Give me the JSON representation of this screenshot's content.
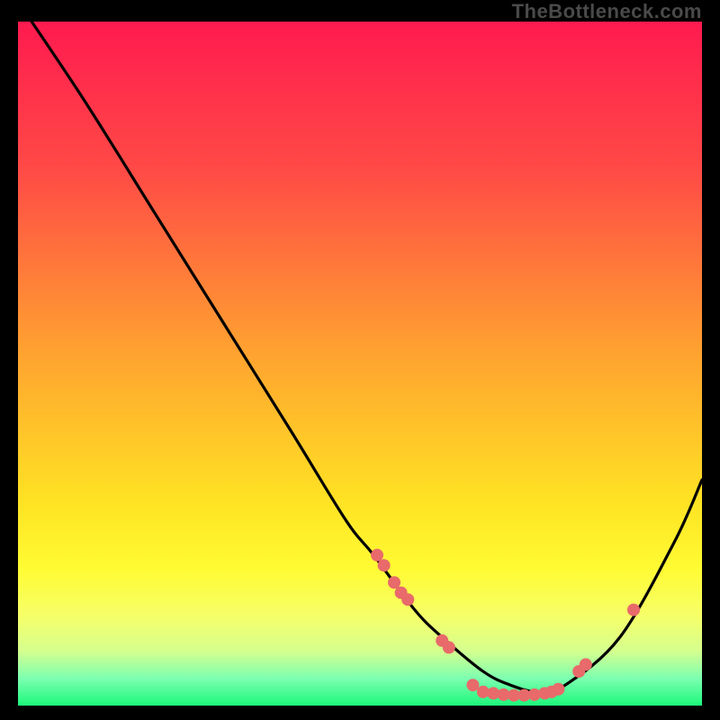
{
  "watermark": "TheBottleneck.com",
  "chart_data": {
    "type": "line",
    "title": "",
    "xlabel": "",
    "ylabel": "",
    "xlim": [
      0,
      100
    ],
    "ylim": [
      0,
      100
    ],
    "grid": false,
    "series": [
      {
        "name": "bottleneck-curve",
        "x": [
          2,
          10,
          20,
          30,
          40,
          48,
          52,
          58,
          62,
          68,
          72,
          76,
          80,
          88,
          96,
          100
        ],
        "values": [
          100,
          88,
          72,
          56,
          40,
          27,
          22,
          14,
          10,
          5,
          3,
          2,
          3,
          10,
          24,
          33
        ],
        "color": "#000000"
      }
    ],
    "markers": [
      {
        "x": 52.5,
        "y": 22.0
      },
      {
        "x": 53.5,
        "y": 20.5
      },
      {
        "x": 55.0,
        "y": 18.0
      },
      {
        "x": 56.0,
        "y": 16.5
      },
      {
        "x": 57.0,
        "y": 15.5
      },
      {
        "x": 62.0,
        "y": 9.5
      },
      {
        "x": 63.0,
        "y": 8.5
      },
      {
        "x": 66.5,
        "y": 3.0
      },
      {
        "x": 68.0,
        "y": 2.0
      },
      {
        "x": 69.5,
        "y": 1.8
      },
      {
        "x": 71.0,
        "y": 1.6
      },
      {
        "x": 72.5,
        "y": 1.5
      },
      {
        "x": 74.0,
        "y": 1.5
      },
      {
        "x": 75.5,
        "y": 1.6
      },
      {
        "x": 77.0,
        "y": 1.8
      },
      {
        "x": 78.0,
        "y": 2.0
      },
      {
        "x": 79.0,
        "y": 2.4
      },
      {
        "x": 82.0,
        "y": 5.0
      },
      {
        "x": 83.0,
        "y": 6.0
      },
      {
        "x": 90.0,
        "y": 14.0
      }
    ],
    "marker_color": "#e86a6a",
    "gradient_stops": [
      {
        "offset": 0,
        "color": "#ff1a4f"
      },
      {
        "offset": 22,
        "color": "#ff4b46"
      },
      {
        "offset": 48,
        "color": "#ffa130"
      },
      {
        "offset": 70,
        "color": "#ffe223"
      },
      {
        "offset": 80,
        "color": "#fffb33"
      },
      {
        "offset": 87,
        "color": "#f6ff6a"
      },
      {
        "offset": 92,
        "color": "#d5ff8e"
      },
      {
        "offset": 96,
        "color": "#7dffb0"
      },
      {
        "offset": 100,
        "color": "#1cf77b"
      }
    ]
  }
}
